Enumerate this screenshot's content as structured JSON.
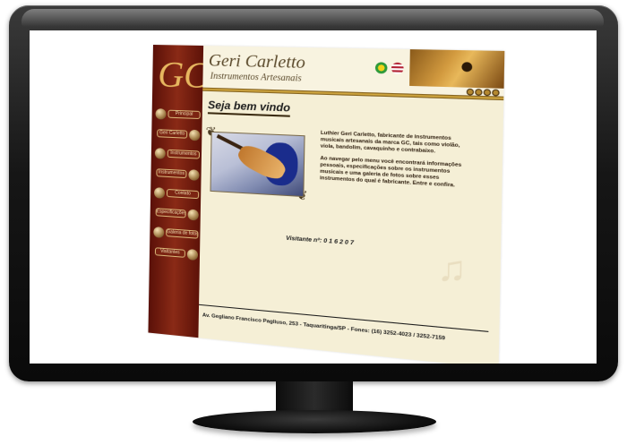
{
  "site": {
    "logo": "GC",
    "brand_name": "Geri Carletto",
    "brand_subtitle": "Instrumentos Artesanais",
    "nav": [
      "Principal",
      "Geri Carletto",
      "Instrumentos",
      "Instrumentos",
      "Contato",
      "Especificações",
      "Galeria de fotos",
      "Visitantes"
    ],
    "welcome_title": "Seja bem vindo",
    "intro_p1": "Luthier Geri Carletto, fabricante de instrumentos musicais artesanais da marca GC, tais como violão, viola, bandolim, cavaquinho e contrabaixo.",
    "intro_p2": "Ao navegar pelo menu você encontrará informações pessoais, especificações sobre os instrumentos musicais e uma galeria de fotos sobre esses instrumentos do qual é fabricante. Entre e confira.",
    "visitor_label": "Visitante nº:",
    "visitor_count": "0 1 6 2 0 7",
    "footer_address": "Av. Gegliano Francisco Pagliuso, 253  -  Taquaritinga/SP  -  Fones: (16) 3252-4023 / 3252-7159"
  }
}
